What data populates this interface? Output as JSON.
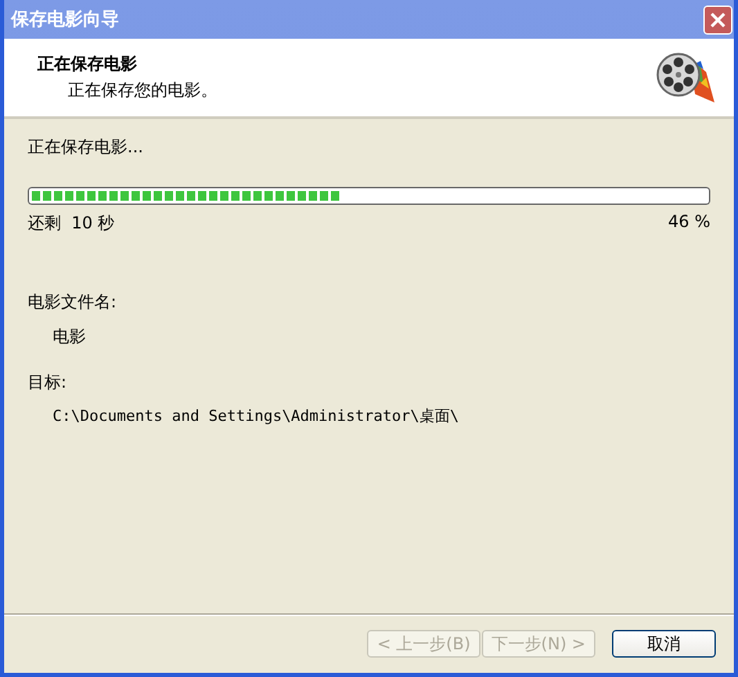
{
  "window": {
    "title": "保存电影向导"
  },
  "header": {
    "title": "正在保存电影",
    "subtitle": "正在保存您的电影。"
  },
  "status": "正在保存电影...",
  "progress": {
    "level": 0.46,
    "remaining": "还剩  10 秒",
    "percent": "46 %"
  },
  "details": [
    {
      "label": "电影文件名:",
      "value": "电影"
    },
    {
      "label": "目标:",
      "value": "C:\\Documents and Settings\\Administrator\\桌面\\"
    }
  ],
  "buttons": [
    {
      "label": "< 上一步(B)",
      "disabled": true
    },
    {
      "label": "下一步(N) >",
      "disabled": true
    },
    {
      "label": "取消",
      "disabled": false
    }
  ]
}
